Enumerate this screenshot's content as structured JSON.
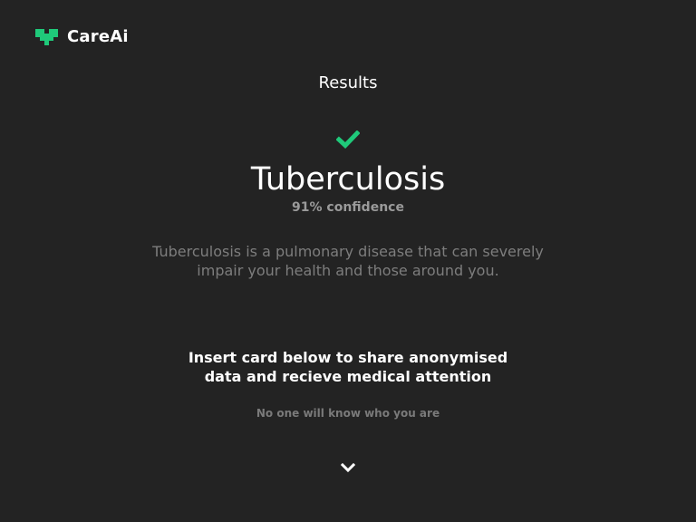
{
  "app": {
    "name": "CareAi",
    "logo_icon": "heart-pixel-icon",
    "accent_color": "#1fc97a"
  },
  "page": {
    "title": "Results"
  },
  "result": {
    "status_icon": "check-icon",
    "diagnosis": "Tuberculosis",
    "confidence": "91% confidence",
    "description": "Tuberculosis is a pulmonary disease that can severely impair your health and those around you."
  },
  "cta": {
    "text": "Insert card below to share anonymised data and recieve medical attention",
    "note": "No one will know who you are",
    "icon": "chevron-down-icon"
  }
}
